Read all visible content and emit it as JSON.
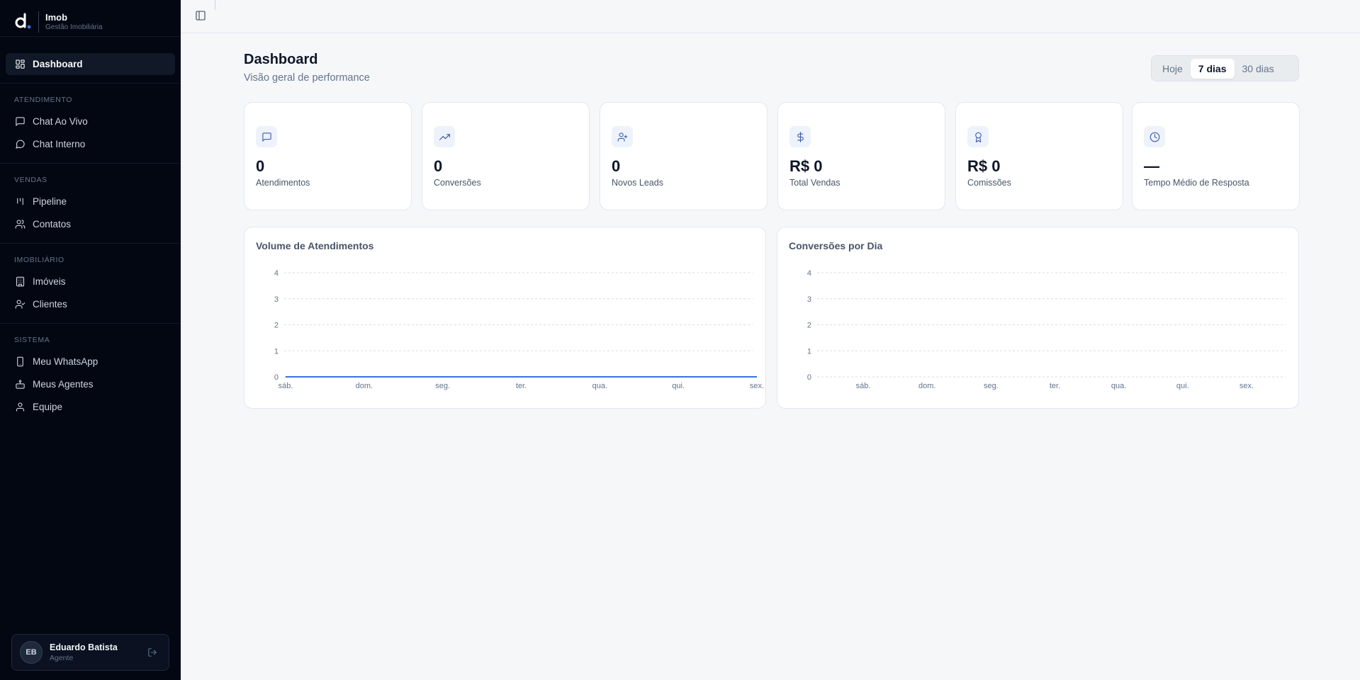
{
  "brand": {
    "name": "Imob",
    "subtitle": "Gestão Imobiliária"
  },
  "sidebar": {
    "dashboard": {
      "label": "Dashboard",
      "icon": "layout-grid-icon"
    },
    "sections": [
      {
        "label": "ATENDIMENTO",
        "items": [
          {
            "label": "Chat Ao Vivo",
            "icon": "message-square-icon"
          },
          {
            "label": "Chat Interno",
            "icon": "message-circle-icon"
          }
        ]
      },
      {
        "label": "VENDAS",
        "items": [
          {
            "label": "Pipeline",
            "icon": "kanban-icon"
          },
          {
            "label": "Contatos",
            "icon": "users-icon"
          }
        ]
      },
      {
        "label": "IMOBILIÁRIO",
        "items": [
          {
            "label": "Imóveis",
            "icon": "building-icon"
          },
          {
            "label": "Clientes",
            "icon": "user-check-icon"
          }
        ]
      },
      {
        "label": "SISTEMA",
        "items": [
          {
            "label": "Meu WhatsApp",
            "icon": "smartphone-icon"
          },
          {
            "label": "Meus Agentes",
            "icon": "bot-icon"
          },
          {
            "label": "Equipe",
            "icon": "user-icon"
          }
        ]
      }
    ]
  },
  "user": {
    "initials": "EB",
    "name": "Eduardo Batista",
    "role": "Agente"
  },
  "header": {
    "title": "Dashboard",
    "subtitle": "Visão geral de performance"
  },
  "range": {
    "options": [
      "Hoje",
      "7 dias",
      "30 dias"
    ],
    "selected": "7 dias"
  },
  "stats": [
    {
      "value": "0",
      "label": "Atendimentos",
      "icon": "message-square-icon"
    },
    {
      "value": "0",
      "label": "Conversões",
      "icon": "trending-up-icon"
    },
    {
      "value": "0",
      "label": "Novos Leads",
      "icon": "user-plus-icon"
    },
    {
      "value": "R$ 0",
      "label": "Total Vendas",
      "icon": "dollar-icon"
    },
    {
      "value": "R$ 0",
      "label": "Comissões",
      "icon": "award-icon"
    },
    {
      "value": "—",
      "label": "Tempo Médio de Resposta",
      "icon": "clock-icon"
    }
  ],
  "chart_data": [
    {
      "type": "line",
      "title": "Volume de Atendimentos",
      "categories": [
        "sáb.",
        "dom.",
        "seg.",
        "ter.",
        "qua.",
        "qui.",
        "sex."
      ],
      "series": [
        {
          "values": [
            0,
            0,
            0,
            0,
            0,
            0,
            0
          ]
        }
      ],
      "ylim": [
        0,
        4
      ],
      "yticks": [
        0,
        1,
        2,
        3,
        4
      ],
      "grid": true,
      "color": "#3b73d9"
    },
    {
      "type": "bar",
      "title": "Conversões por Dia",
      "categories": [
        "sáb.",
        "dom.",
        "seg.",
        "ter.",
        "qua.",
        "qui.",
        "sex."
      ],
      "series": [
        {
          "values": [
            0,
            0,
            0,
            0,
            0,
            0,
            0
          ]
        }
      ],
      "ylim": [
        0,
        4
      ],
      "yticks": [
        0,
        1,
        2,
        3,
        4
      ],
      "grid": true
    }
  ]
}
